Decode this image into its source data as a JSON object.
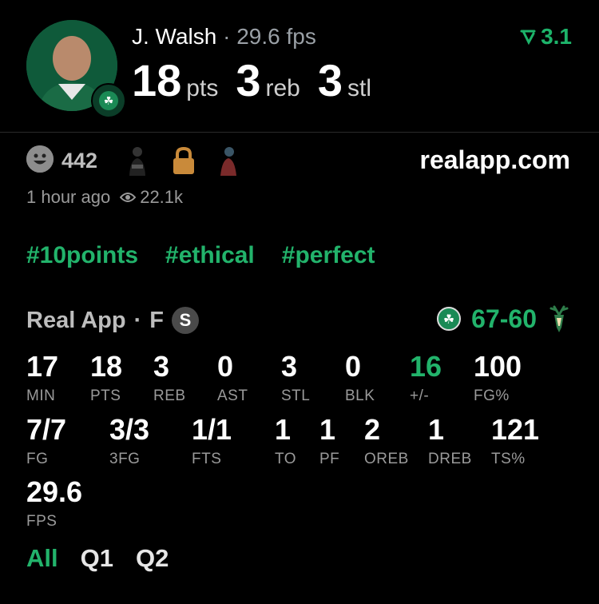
{
  "header": {
    "player_name": "J. Walsh",
    "separator": "·",
    "fps_text": "29.6 fps",
    "trend_value": "3.1",
    "stats": [
      {
        "value": "18",
        "unit": "pts"
      },
      {
        "value": "3",
        "unit": "reb"
      },
      {
        "value": "3",
        "unit": "stl"
      }
    ],
    "colors": {
      "accent": "#22b36b",
      "team": "#0f5a3a"
    }
  },
  "post": {
    "reaction_count": "442",
    "site": "realapp.com",
    "time_ago": "1 hour ago",
    "views": "22.1k",
    "icons": [
      "smiley-icon",
      "avatar-icon",
      "lock-icon",
      "avatar-icon"
    ]
  },
  "tags": [
    "#10points",
    "#ethical",
    "#perfect"
  ],
  "game": {
    "league": "Real App",
    "separator": "·",
    "position": "F",
    "badge": "S",
    "score": "67-60"
  },
  "stats_row1": [
    {
      "value": "17",
      "label": "MIN"
    },
    {
      "value": "18",
      "label": "PTS"
    },
    {
      "value": "3",
      "label": "REB"
    },
    {
      "value": "0",
      "label": "AST"
    },
    {
      "value": "3",
      "label": "STL"
    },
    {
      "value": "0",
      "label": "BLK"
    },
    {
      "value": "16",
      "label": "+/-",
      "highlight": true
    },
    {
      "value": "100",
      "label": "FG%"
    }
  ],
  "stats_row2": [
    {
      "value": "7/7",
      "label": "FG"
    },
    {
      "value": "3/3",
      "label": "3FG"
    },
    {
      "value": "1/1",
      "label": "FTS"
    },
    {
      "value": "1",
      "label": "TO"
    },
    {
      "value": "1",
      "label": "PF"
    },
    {
      "value": "2",
      "label": "OREB"
    },
    {
      "value": "1",
      "label": "DREB"
    },
    {
      "value": "121",
      "label": "TS%"
    }
  ],
  "stats_row3": [
    {
      "value": "29.6",
      "label": "FPS"
    }
  ],
  "filters": {
    "items": [
      "All",
      "Q1",
      "Q2"
    ],
    "active": "All"
  }
}
